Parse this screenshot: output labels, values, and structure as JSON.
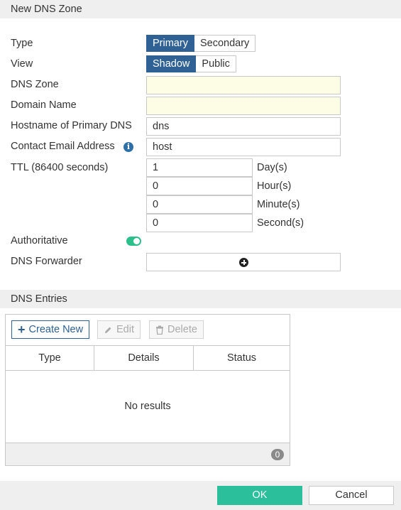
{
  "header": {
    "title": "New DNS Zone"
  },
  "form": {
    "type": {
      "label": "Type",
      "options": [
        "Primary",
        "Secondary"
      ],
      "selected": "Primary"
    },
    "view": {
      "label": "View",
      "options": [
        "Shadow",
        "Public"
      ],
      "selected": "Shadow"
    },
    "dns_zone": {
      "label": "DNS Zone",
      "value": ""
    },
    "domain_name": {
      "label": "Domain Name",
      "value": ""
    },
    "primary_dns": {
      "label": "Hostname of Primary DNS",
      "value": "dns"
    },
    "contact_email": {
      "label": "Contact Email Address",
      "value": "host",
      "icon": "info-icon"
    },
    "ttl": {
      "label": "TTL (86400 seconds)",
      "days": "1",
      "days_unit": "Day(s)",
      "hours": "0",
      "hours_unit": "Hour(s)",
      "minutes": "0",
      "minutes_unit": "Minute(s)",
      "seconds": "0",
      "seconds_unit": "Second(s)"
    },
    "authoritative": {
      "label": "Authoritative",
      "enabled": true
    },
    "dns_forwarder": {
      "label": "DNS Forwarder",
      "icon": "plus-circle-icon"
    }
  },
  "entries": {
    "title": "DNS Entries",
    "toolbar": {
      "create": "Create New",
      "edit": "Edit",
      "delete": "Delete"
    },
    "columns": [
      "Type",
      "Details",
      "Status"
    ],
    "empty_text": "No results",
    "count": "0"
  },
  "footer": {
    "ok": "OK",
    "cancel": "Cancel"
  },
  "colors": {
    "primary": "#2f6194",
    "accent": "#2bbf9c",
    "required_bg": "#fdfde5"
  }
}
